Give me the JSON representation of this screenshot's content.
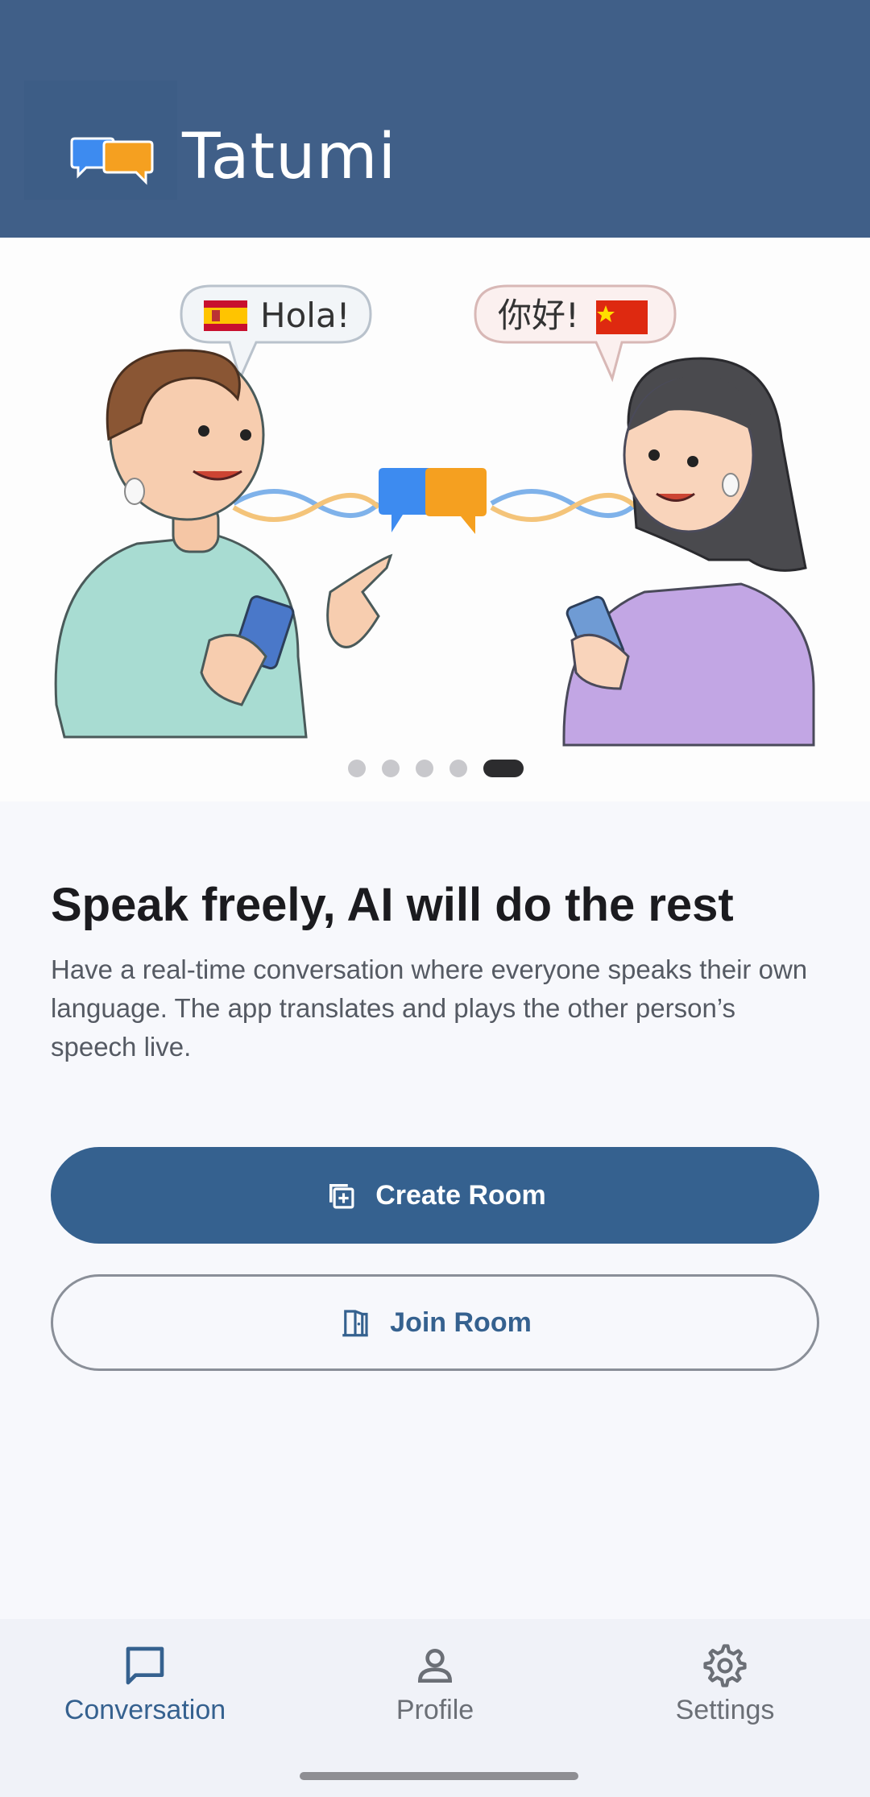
{
  "header": {
    "app_name": "Tatumi",
    "logo_icon": "chat-bubbles-icon"
  },
  "hero": {
    "bubble_left": {
      "text": "Hola!",
      "flag": "spain-flag-icon"
    },
    "bubble_right": {
      "text": "你好!",
      "flag": "china-flag-icon"
    },
    "carousel": {
      "total": 5,
      "active_index": 4
    }
  },
  "intro": {
    "headline": "Speak freely, AI will do the rest",
    "description": "Have a real-time conversation where everyone speaks their own language. The app translates and plays the other person’s speech live."
  },
  "actions": {
    "create_room": {
      "label": "Create Room",
      "icon": "add-box-icon"
    },
    "join_room": {
      "label": "Join Room",
      "icon": "door-icon"
    }
  },
  "nav": {
    "items": [
      {
        "label": "Conversation",
        "icon": "chat-icon",
        "active": true
      },
      {
        "label": "Profile",
        "icon": "person-icon",
        "active": false
      },
      {
        "label": "Settings",
        "icon": "gear-icon",
        "active": false
      }
    ]
  },
  "colors": {
    "header_bg": "#405f88",
    "primary": "#35618f",
    "background": "#f7f8fc",
    "bubble_blue": "#3d8bf0",
    "bubble_orange": "#f5a020"
  }
}
